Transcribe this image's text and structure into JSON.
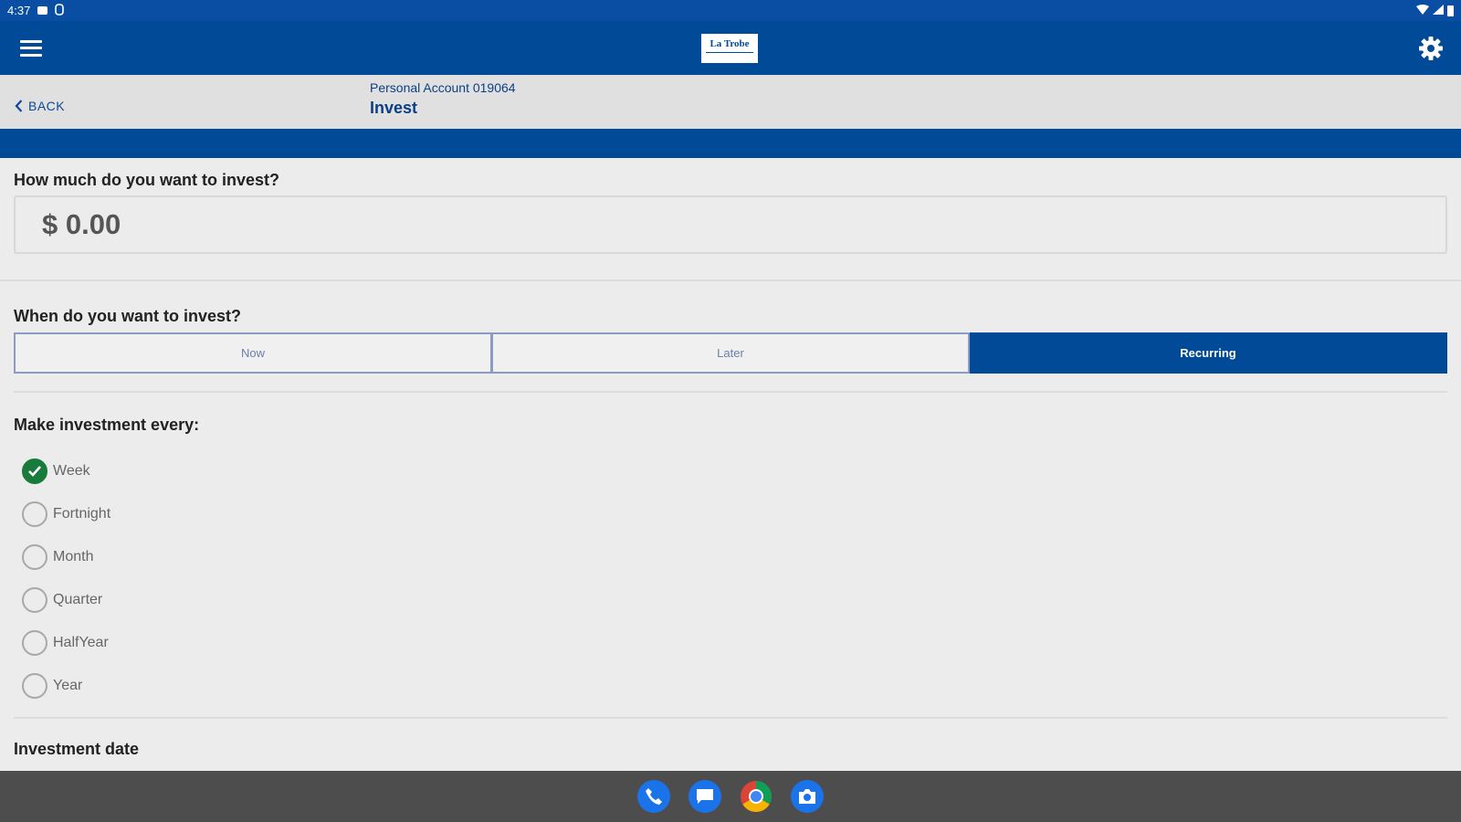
{
  "status_bar": {
    "time": "4:37"
  },
  "header": {
    "logo_text": "La Trobe"
  },
  "sub_header": {
    "back_label": "BACK",
    "account": "Personal Account 019064",
    "page_title": "Invest"
  },
  "amount": {
    "question": "How much do you want to invest?",
    "value": "$ 0.00"
  },
  "timing": {
    "question": "When do you want to invest?",
    "options": [
      "Now",
      "Later",
      "Recurring"
    ],
    "selected": "Recurring"
  },
  "frequency": {
    "question": "Make investment every:",
    "options": [
      "Week",
      "Fortnight",
      "Month",
      "Quarter",
      "HalfYear",
      "Year"
    ],
    "selected": "Week"
  },
  "investment_date": {
    "label": "Investment date"
  },
  "dock": {
    "icons": [
      "phone-icon",
      "messages-icon",
      "chrome-icon",
      "camera-icon"
    ]
  },
  "colors": {
    "brand_blue": "#004a98",
    "check_green": "#187a3b"
  }
}
